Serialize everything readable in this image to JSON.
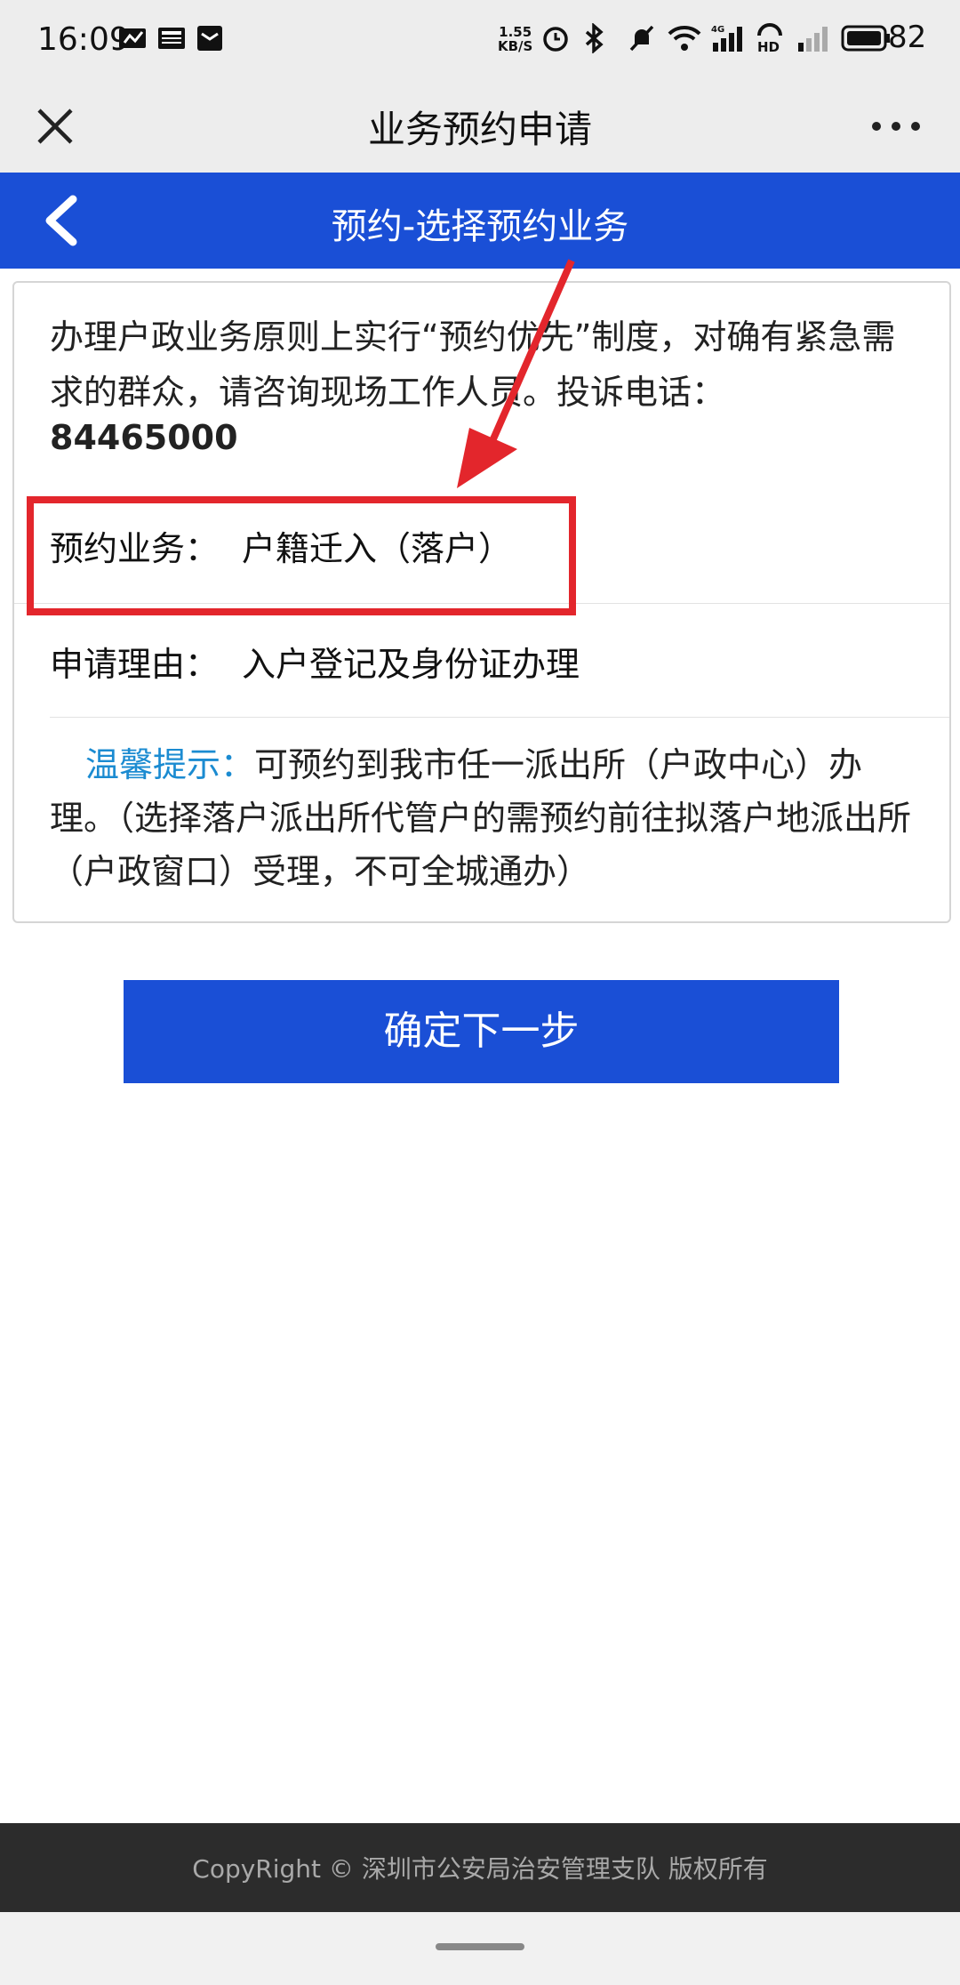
{
  "status_bar": {
    "time": "16:09",
    "net_speed_value": "1.55",
    "net_speed_unit": "KB/S",
    "network_label": "4G",
    "hd_label": "HD",
    "battery": "82"
  },
  "titlebar": {
    "title": "业务预约申请"
  },
  "subheader": {
    "title": "预约-选择预约业务"
  },
  "card": {
    "notice_text": "办理户政业务原则上实行“预约优先”制度，对确有紧急需求的群众，请咨询现场工作人员。投诉电话：",
    "phone": "84465000",
    "service_label": "预约业务：",
    "service_value": "户籍迁入（落户）",
    "reason_label": "申请理由：",
    "reason_value": "入户登记及身份证办理",
    "tip_label": "温馨提示：",
    "tip_text": "可预约到我市任一派出所（户政中心）办理。（选择落户派出所代管户的需预约前往拟落户地派出所（户政窗口）受理，不可全城通办）"
  },
  "next_button_label": "确定下一步",
  "footer": {
    "copyright": "CopyRight © 深圳市公安局治安管理支队 版权所有"
  },
  "colors": {
    "primary_blue": "#1a4fd6",
    "tip_blue": "#1b8bd1",
    "annotation_red": "#e3262c",
    "footer_bg": "#2c2c2c"
  },
  "icons": [
    "close-icon",
    "more-icon",
    "back-icon",
    "alarm-icon",
    "bluetooth-icon",
    "mute-icon",
    "wifi-icon",
    "signal-icon",
    "battery-icon"
  ]
}
